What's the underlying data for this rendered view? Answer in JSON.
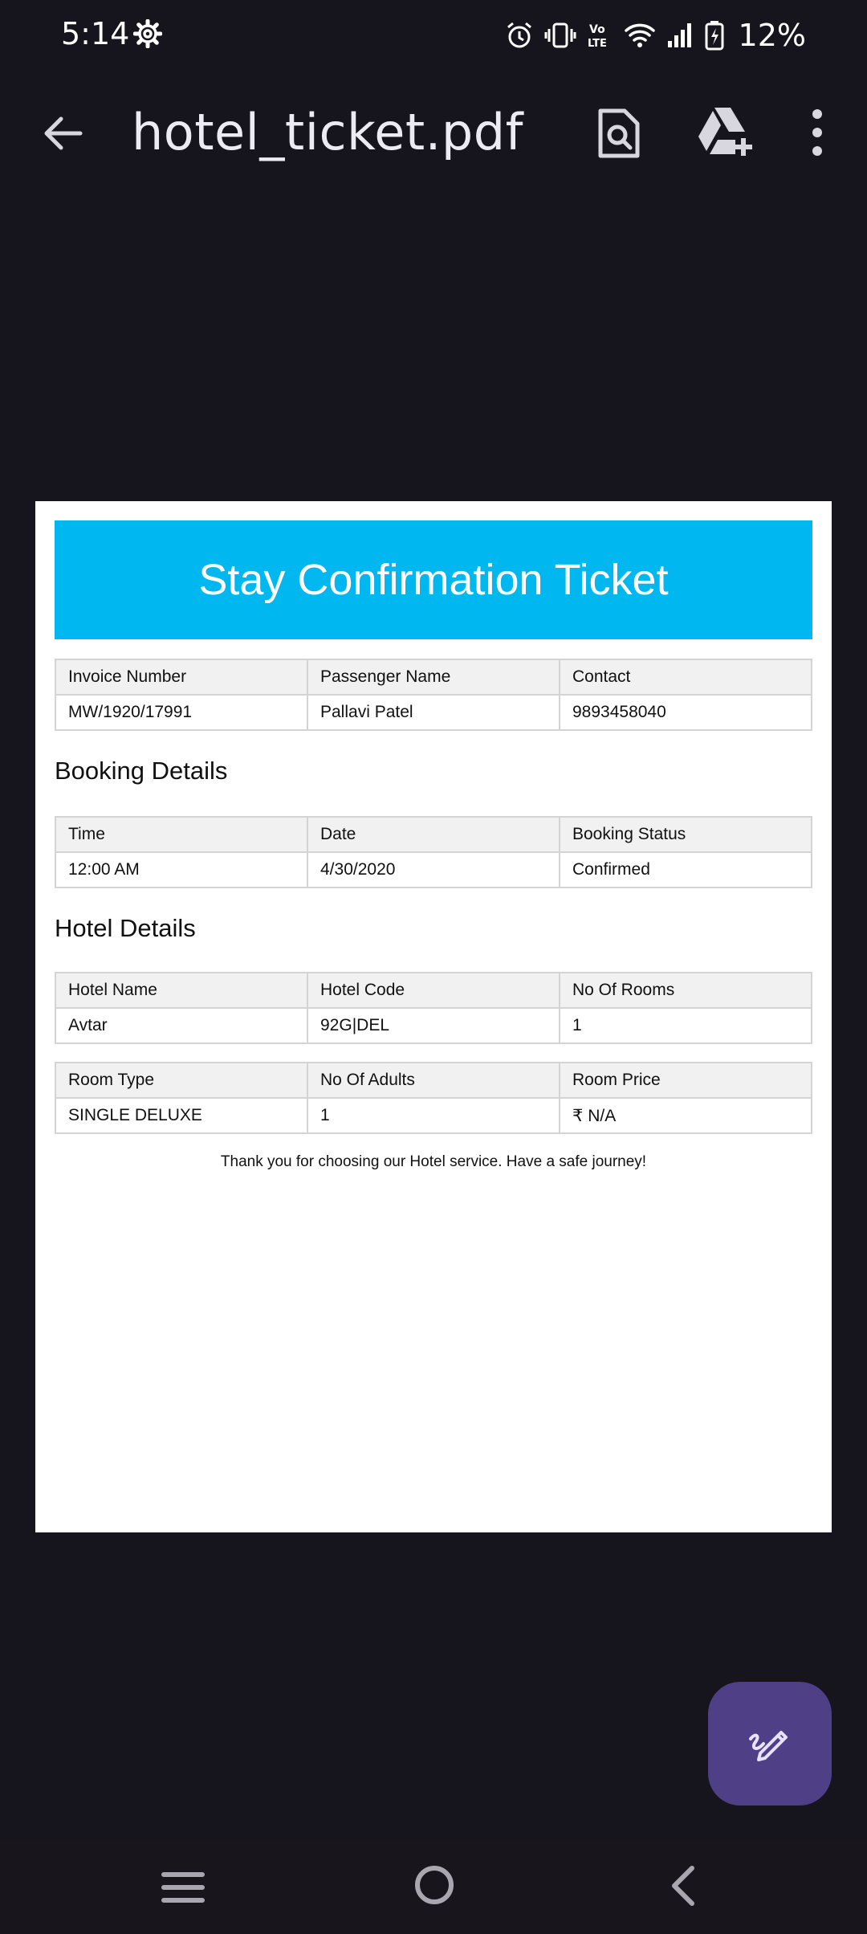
{
  "status_bar": {
    "time": "5:14",
    "battery": "12%",
    "icons": [
      "settings-icon",
      "alarm-icon",
      "vibrate-icon",
      "volte-icon",
      "wifi-icon",
      "signal-icon",
      "battery-charging-icon"
    ]
  },
  "app_bar": {
    "title": "hotel_ticket.pdf",
    "icons": [
      "back-arrow-icon",
      "search-document-icon",
      "drive-add-icon",
      "more-vertical-icon"
    ]
  },
  "document": {
    "banner_title": "Stay Confirmation Ticket",
    "banner_color": "#00b7ef",
    "invoice_table": {
      "headers": [
        "Invoice Number",
        "Passenger Name",
        "Contact"
      ],
      "row": [
        "MW/1920/17991",
        "Pallavi Patel",
        "9893458040"
      ]
    },
    "booking_section_title": "Booking Details",
    "booking_table": {
      "headers": [
        "Time",
        "Date",
        "Booking Status"
      ],
      "row": [
        "12:00 AM",
        "4/30/2020",
        "Confirmed"
      ]
    },
    "hotel_section_title": "Hotel Details",
    "hotel_table": {
      "headers": [
        "Hotel Name",
        "Hotel Code",
        "No Of Rooms"
      ],
      "row": [
        "Avtar",
        "92G|DEL",
        "1"
      ]
    },
    "room_table": {
      "headers": [
        "Room Type",
        "No Of Adults",
        "Room Price"
      ],
      "row": [
        "SINGLE DELUXE",
        "1",
        "₹ N/A"
      ]
    },
    "thanks_text": "Thank you for choosing our Hotel service. Have a safe journey!"
  },
  "fab": {
    "icon": "edit-pen-icon",
    "color": "#4f3f86"
  },
  "nav_bar": {
    "icons": [
      "recents-menu-icon",
      "home-circle-icon",
      "back-chevron-icon"
    ]
  }
}
